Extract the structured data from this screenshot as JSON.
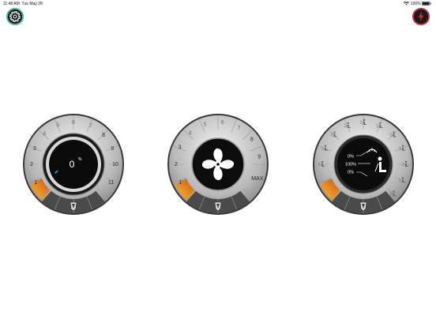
{
  "status_bar": {
    "time": "11:48 AM",
    "date": "Tue May 28",
    "battery": "100%"
  },
  "icons": {
    "settings": "gear-icon",
    "power": "power-icon",
    "fan": "fan-icon",
    "seat": "seat-airflow-icon",
    "defrost": "windshield-defrost-icon",
    "brand": "brand-logo-icon"
  },
  "colors": {
    "settings_ring": "#3fb89f",
    "power_ring": "#c62d3d",
    "knob_accent": "#ff8c1a",
    "indicator": "#2d8fe0"
  },
  "temperature_dial": {
    "value": "0",
    "unit": "%",
    "scale": [
      "1",
      "2",
      "3",
      "4",
      "5",
      "6",
      "7",
      "8",
      "9",
      "10",
      "11"
    ]
  },
  "fan_dial": {
    "scale": [
      "1",
      "2",
      "3",
      "4",
      "5",
      "6",
      "7",
      "8",
      "9",
      "MAX"
    ]
  },
  "airflow_dial": {
    "upper": "0%",
    "middle": "100%",
    "lower": "0%"
  }
}
